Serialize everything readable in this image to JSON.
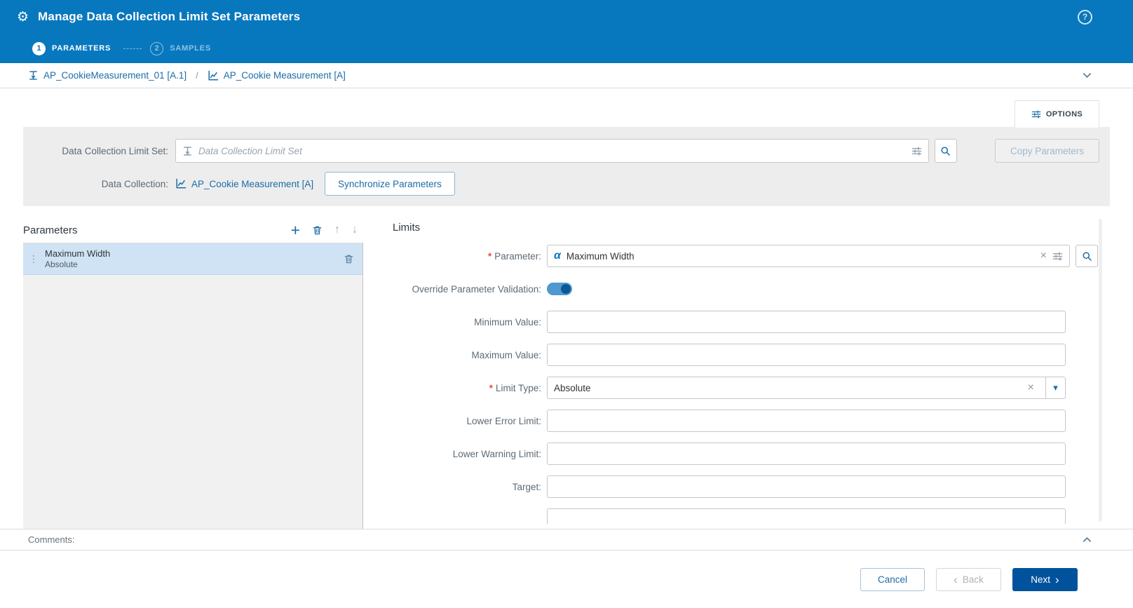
{
  "colors": {
    "header_bg": "#0878be",
    "accent_blue": "#1b6ca8",
    "primary_button": "#00529c",
    "selected_row": "#cfe3f4",
    "required_marker": "#e0552d",
    "panel_gray": "#ededed"
  },
  "header": {
    "title": "Manage Data Collection Limit Set Parameters"
  },
  "wizard": {
    "steps": [
      {
        "number": "1",
        "label": "PARAMETERS",
        "state": "active"
      },
      {
        "number": "2",
        "label": "SAMPLES",
        "state": "upcoming"
      }
    ]
  },
  "breadcrumb": {
    "limit_set": "AP_CookieMeasurement_01 [A.1]",
    "separator": "/",
    "data_collection": "AP_Cookie Measurement [A]"
  },
  "options_tab": {
    "label": "OPTIONS"
  },
  "top_form": {
    "limit_set_label": "Data Collection Limit Set:",
    "limit_set_placeholder": "Data Collection Limit Set",
    "data_collection_label": "Data Collection:",
    "data_collection_value": "AP_Cookie Measurement [A]",
    "sync_button": "Synchronize Parameters",
    "copy_button": "Copy Parameters"
  },
  "parameters_panel": {
    "title": "Parameters",
    "selected_item": {
      "name": "Maximum Width",
      "subtitle": "Absolute",
      "selected": true
    }
  },
  "limits_panel": {
    "title": "Limits",
    "required_marker": "*",
    "parameter_label": "Parameter:",
    "parameter_value": "Maximum Width",
    "override_label": "Override Parameter Validation:",
    "override_on": true,
    "minimum_label": "Minimum Value:",
    "minimum_value": "",
    "maximum_label": "Maximum Value:",
    "maximum_value": "",
    "limit_type_label": "Limit Type:",
    "limit_type_value": "Absolute",
    "lower_error_label": "Lower Error Limit:",
    "lower_error_value": "",
    "lower_warning_label": "Lower Warning Limit:",
    "lower_warning_value": "",
    "target_label": "Target:",
    "target_value": ""
  },
  "comments": {
    "label": "Comments:"
  },
  "footer": {
    "cancel": "Cancel",
    "back": "Back",
    "next": "Next",
    "back_chevron": "‹",
    "next_chevron": "›"
  },
  "glyphs": {
    "gear": "⚙",
    "help": "?",
    "alpha": "α",
    "clear": "×",
    "plus": "+",
    "arrow_up": "↑",
    "arrow_down": "↓",
    "drag_handle": "⋮",
    "caret_down": "▾"
  }
}
